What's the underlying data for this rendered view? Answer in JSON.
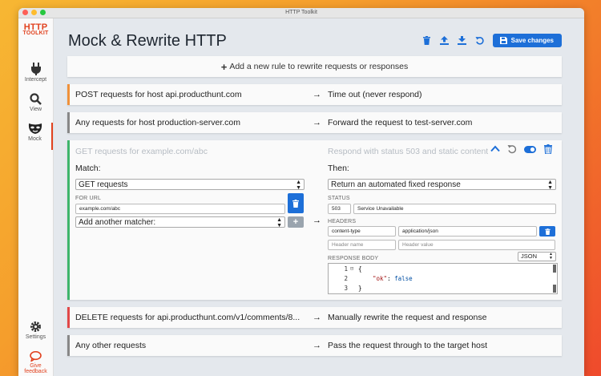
{
  "window": {
    "title": "HTTP Toolkit"
  },
  "sidebar": {
    "logo_line1": "HTTP",
    "logo_line2": "TOOLKIT",
    "items": [
      {
        "label": "Intercept",
        "icon": "plug-icon"
      },
      {
        "label": "View",
        "icon": "search-icon"
      },
      {
        "label": "Mock",
        "icon": "mask-icon",
        "active": true
      }
    ],
    "settings_label": "Settings",
    "feedback_line1": "Give",
    "feedback_line2": "feedback"
  },
  "header": {
    "title": "Mock & Rewrite HTTP",
    "save_label": "Save changes"
  },
  "add_rule": {
    "label": "Add a new rule to rewrite requests or responses"
  },
  "rules": [
    {
      "match": "POST requests for host api.producthunt.com",
      "action": "Time out (never respond)",
      "color": "#f0913a"
    },
    {
      "match": "Any requests for host production-server.com",
      "action": "Forward the request to test-server.com",
      "color": "#888888"
    }
  ],
  "expanded_rule": {
    "summary_match": "GET requests for example.com/abc",
    "summary_action": "Respond with status 503 and static content",
    "match_heading": "Match:",
    "then_heading": "Then:",
    "method_select": "GET requests",
    "for_url_label": "FOR URL",
    "url_value": "example.com/abc",
    "add_matcher": "Add another matcher:",
    "action_select": "Return an automated fixed response",
    "status_label": "STATUS",
    "status_code": "503",
    "status_message": "Service Unavailable",
    "headers_label": "HEADERS",
    "header_name": "content-type",
    "header_value": "application/json",
    "header_name_placeholder": "Header name",
    "header_value_placeholder": "Header value",
    "body_label": "RESPONSE BODY",
    "body_format": "JSON",
    "code_lines": [
      "1",
      "2",
      "3"
    ],
    "code_open": "{",
    "code_key": "\"ok\"",
    "code_colon": ": ",
    "code_val": "false",
    "code_close": "}"
  },
  "bottom_rules": [
    {
      "match": "DELETE requests for api.producthunt.com/v1/comments/8...",
      "action": "Manually rewrite the request and response",
      "color": "#e14848"
    },
    {
      "match": "Any other requests",
      "action": "Pass the request through to the target host",
      "color": "#888888"
    }
  ],
  "colors": {
    "accent": "#1d6fd8",
    "brand": "#e1421f",
    "match_ok": "#3eb56b"
  }
}
